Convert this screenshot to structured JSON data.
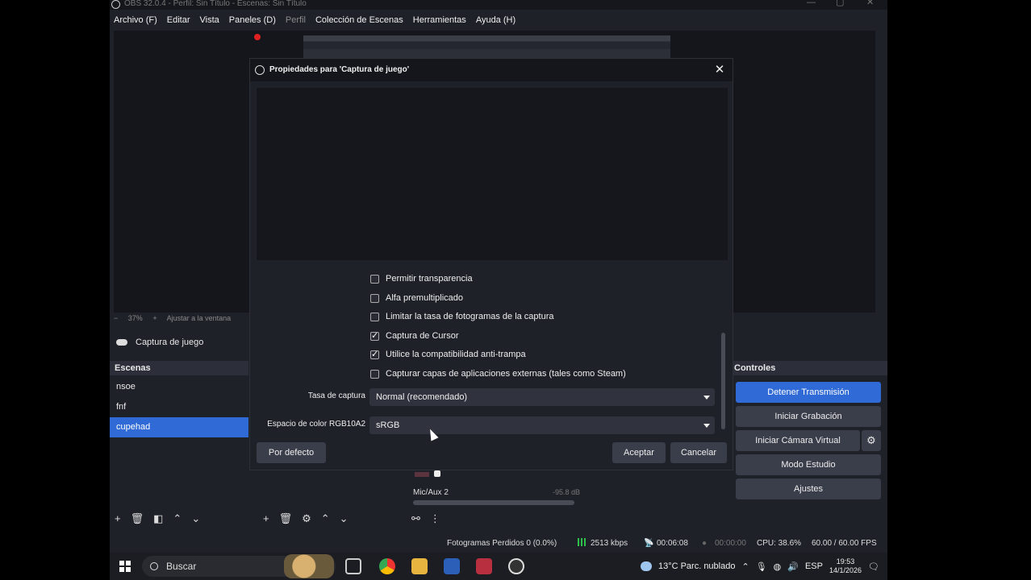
{
  "window": {
    "title": "OBS 32.0.4 - Perfil: Sin Título - Escenas: Sin Título"
  },
  "menu": [
    "Archivo (F)",
    "Editar",
    "Vista",
    "Paneles (D)",
    "Perfil",
    "Colección de Escenas",
    "Herramientas",
    "Ayuda (H)"
  ],
  "zoom": {
    "percent": "37%",
    "fit_label": "Ajustar a la ventana"
  },
  "source_bar": {
    "label": "Captura de juego"
  },
  "scenes": {
    "title": "Escenas",
    "items": [
      "nsoe",
      "fnf",
      "cupehad"
    ],
    "selected": "cupehad"
  },
  "mixer": {
    "channel": "Mic/Aux 2",
    "db": "-95.8 dB"
  },
  "controls": {
    "title": "Controles",
    "buttons": [
      "Detener Transmisión",
      "Iniciar Grabación",
      "Iniciar Cámara Virtual",
      "Modo Estudio",
      "Ajustes"
    ]
  },
  "status": {
    "dropped": "Fotogramas Perdidos 0 (0.0%)",
    "bitrate": "2513 kbps",
    "stream_time": "00:06:08",
    "rec_time": "00:00:00",
    "cpu": "CPU: 38.6%",
    "fps": "60.00 / 60.00 FPS"
  },
  "dialog": {
    "title": "Propiedades para 'Captura de juego'",
    "checkboxes": [
      {
        "label": "Permitir transparencia",
        "checked": false
      },
      {
        "label": "Alfa premultiplicado",
        "checked": false
      },
      {
        "label": "Limitar la tasa de fotogramas de la captura",
        "checked": false
      },
      {
        "label": "Captura de Cursor",
        "checked": true
      },
      {
        "label": "Utilice la compatibilidad anti-trampa",
        "checked": true
      },
      {
        "label": "Capturar capas de aplicaciones externas (tales como Steam)",
        "checked": false
      }
    ],
    "rate_label": "Tasa de captura",
    "rate_value": "Normal (recomendado)",
    "color_label": "Espacio de color RGB10A2",
    "color_value": "sRGB",
    "default_btn": "Por defecto",
    "ok_btn": "Aceptar",
    "cancel_btn": "Cancelar"
  },
  "taskbar": {
    "search": "Buscar",
    "weather": "13°C  Parc. nublado",
    "lang": "ESP",
    "time": "19:53",
    "date": "14/1/2026"
  }
}
